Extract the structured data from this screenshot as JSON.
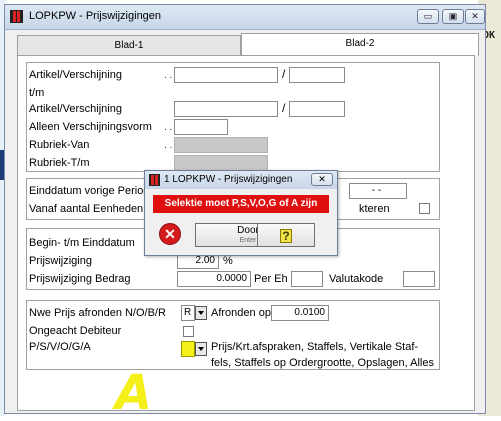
{
  "window": {
    "title": "LOPKPW - Prijswijzigingen",
    "buttons": {
      "minimize": "▭",
      "maximize": "▣",
      "close": "✕"
    }
  },
  "side_button": {
    "ok": "OK"
  },
  "tabs": [
    "Blad-1",
    "Blad-2"
  ],
  "section1": {
    "artikel_label": "Artikel/Verschijning",
    "tm_label": "t/m",
    "artikel2_label": "Artikel/Verschijning",
    "alleen_label": "Alleen Verschijningsvorm",
    "rubriek_van_label": "Rubriek-Van",
    "rubriek_tm_label": "Rubriek-T/m",
    "dots": ". .",
    "slash": "/"
  },
  "section2": {
    "einddatum_label": "Einddatum vorige Periode",
    "vanaf_label": "Vanaf aantal Eenheden",
    "date_value": "- -",
    "partial_label": "kteren"
  },
  "section3": {
    "begin_label": "Begin- t/m Einddatum",
    "prijswijziging_label": "Prijswijziging",
    "prijswijziging_value": "2.00",
    "percent": "%",
    "bedrag_label": "Prijswijziging Bedrag",
    "bedrag_value": "0.0000",
    "per_eh": "Per Eh",
    "valutakode": "Valutakode"
  },
  "section4": {
    "nwe_prijs_label": "Nwe Prijs afronden N/O/B/R",
    "nwe_prijs_value": "R",
    "afronden_label": "Afronden op",
    "afronden_value": "0.0100",
    "ongeacht_label": "Ongeacht Debiteur",
    "psvoga_label": "P/S/V/O/G/A",
    "psvoga_desc_line1": "Prijs/Krt.afspraken, Staffels, Vertikale Staf-",
    "psvoga_desc_line2": "fels, Staffels op Ordergrootte, Opslagen, Alles"
  },
  "dialog": {
    "title": "1 LOPKPW - Prijswijzigingen",
    "close": "✕",
    "message": "Selektie moet P,S,V,O,G of A zijn",
    "door_label": "Door",
    "door_sub": "Enter",
    "help_glyph": "?"
  },
  "annotation": {
    "letter": "A"
  },
  "colors": {
    "error_red": "#e01010",
    "highlight_yellow": "#f5f01a",
    "titlebar": "#c7d5e8"
  }
}
